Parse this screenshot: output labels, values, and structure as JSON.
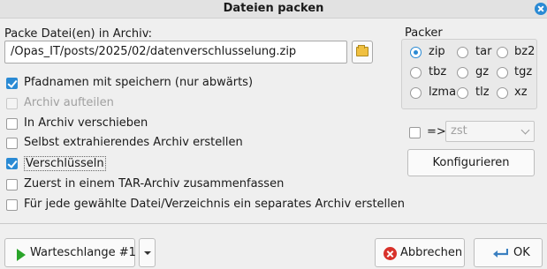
{
  "window": {
    "title": "Dateien packen"
  },
  "archive": {
    "label": "Packe Datei(en) in Archiv:",
    "path": "/Opas_IT/posts/2025/02/datenverschlusselung.zip"
  },
  "options": [
    {
      "label": "Pfadnamen mit speichern (nur abwärts)",
      "checked": true,
      "enabled": true
    },
    {
      "label": "Archiv aufteilen",
      "checked": false,
      "enabled": false
    },
    {
      "label": "In Archiv verschieben",
      "checked": false,
      "enabled": true
    },
    {
      "label": "Selbst extrahierendes Archiv erstellen",
      "checked": false,
      "enabled": true
    },
    {
      "label": "Verschlüsseln",
      "checked": true,
      "enabled": true
    },
    {
      "label": "Zuerst in einem TAR-Archiv zusammenfassen",
      "checked": false,
      "enabled": true
    },
    {
      "label": "Für jede gewählte Datei/Verzeichnis ein separates Archiv erstellen",
      "checked": false,
      "enabled": true
    }
  ],
  "packer": {
    "label": "Packer",
    "selected": "zip",
    "formats": [
      "zip",
      "tar",
      "bz2",
      "tbz",
      "gz",
      "tgz",
      "lzma",
      "tlz",
      "xz"
    ]
  },
  "convert": {
    "arrow": "=>",
    "value": "zst",
    "checked": false
  },
  "buttons": {
    "configure": "Konfigurieren",
    "queue": "Warteschlange #1",
    "cancel": "Abbrechen",
    "ok": "OK"
  },
  "colors": {
    "accent": "#2a8ad4",
    "play": "#2aa52a",
    "cancel": "#d8312a"
  },
  "icons": {
    "close": "close-icon",
    "browse": "folder-icon",
    "queue": "play-icon",
    "dropdown": "chevron-down-icon",
    "cancel": "cancel-icon",
    "ok": "ok-icon"
  }
}
